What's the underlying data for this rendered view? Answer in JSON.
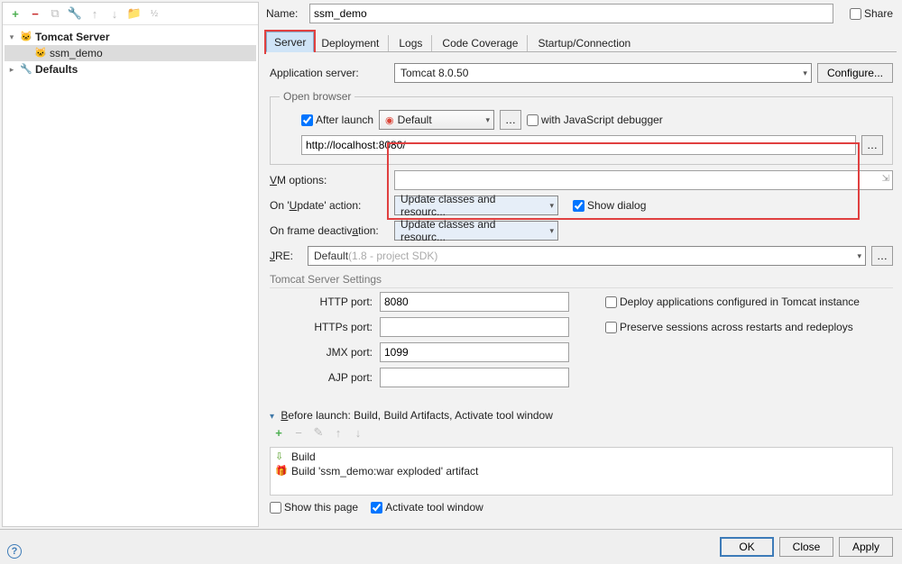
{
  "name_label": "Name:",
  "name_value": "ssm_demo",
  "share_label": "Share",
  "sidebar": {
    "nodes": [
      {
        "label": "Tomcat Server",
        "bold": true
      },
      {
        "label": "ssm_demo",
        "selected": true
      },
      {
        "label": "Defaults",
        "bold": true
      }
    ]
  },
  "tabs": [
    "Server",
    "Deployment",
    "Logs",
    "Code Coverage",
    "Startup/Connection"
  ],
  "active_tab": "Server",
  "app_server_label": "Application server:",
  "app_server_value": "Tomcat 8.0.50",
  "configure_btn": "Configure...",
  "open_browser_legend": "Open browser",
  "after_launch_label": "After launch",
  "browser_label": "Default",
  "js_debugger_label": "with JavaScript debugger",
  "url_value": "http://localhost:8080/",
  "vm_options_label": "VM options:",
  "update_action_label": "On 'Update' action:",
  "update_action_value": "Update classes and resourc...",
  "show_dialog_label": "Show dialog",
  "frame_deact_label": "On frame deactivation:",
  "frame_deact_value": "Update classes and resourc...",
  "jre_label": "JRE:",
  "jre_value": "Default (1.8 - project SDK)",
  "tomcat_settings_legend": "Tomcat Server Settings",
  "http_port_label": "HTTP port:",
  "http_port_value": "8080",
  "https_port_label": "HTTPs port:",
  "https_port_value": "",
  "jmx_port_label": "JMX port:",
  "jmx_port_value": "1099",
  "ajp_port_label": "AJP port:",
  "ajp_port_value": "",
  "deploy_cfg_label": "Deploy applications configured in Tomcat instance",
  "preserve_sessions_label": "Preserve sessions across restarts and redeploys",
  "before_launch_label": "Before launch: Build, Build Artifacts, Activate tool window",
  "before_items": [
    "Build",
    "Build 'ssm_demo:war exploded' artifact"
  ],
  "show_page_label": "Show this page",
  "activate_tool_label": "Activate tool window",
  "ok_btn": "OK",
  "close_btn": "Close",
  "apply_btn": "Apply"
}
